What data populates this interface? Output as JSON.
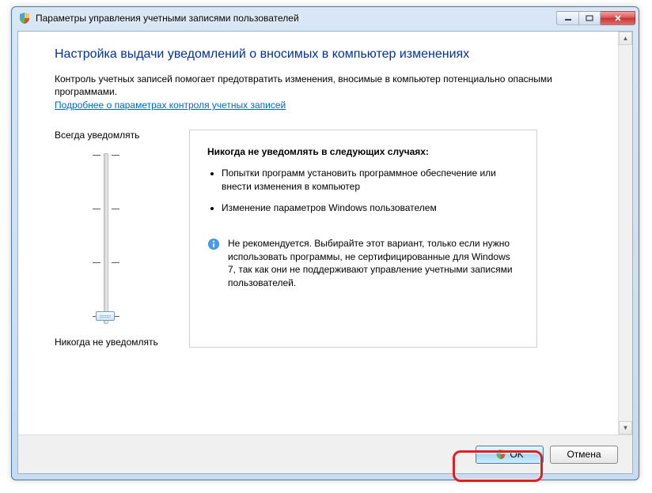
{
  "window": {
    "title": "Параметры управления учетными записями пользователей"
  },
  "heading": "Настройка выдачи уведомлений о вносимых в компьютер изменениях",
  "intro": "Контроль учетных записей помогает предотвратить изменения, вносимые в компьютер потенциально опасными программами.",
  "help_link": "Подробнее о параметрах контроля учетных записей",
  "slider": {
    "top_label": "Всегда уведомлять",
    "bottom_label": "Никогда не уведомлять",
    "position": 3,
    "steps": 4
  },
  "description": {
    "title": "Никогда не уведомлять в следующих случаях:",
    "bullets": [
      "Попытки программ установить программное обеспечение или внести изменения в компьютер",
      "Изменение параметров Windows пользователем"
    ],
    "warning": "Не рекомендуется. Выбирайте этот вариант, только если нужно использовать программы, не сертифицированные для Windows 7, так как они не поддерживают управление учетными записями пользователей."
  },
  "buttons": {
    "ok": "OK",
    "cancel": "Отмена"
  },
  "colors": {
    "heading": "#003399",
    "link": "#0066cc",
    "highlight": "#e02020"
  }
}
